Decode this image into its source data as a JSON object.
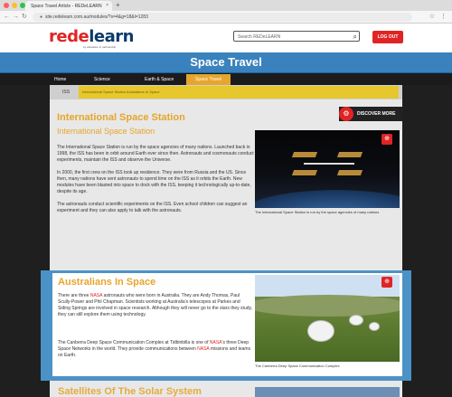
{
  "browser": {
    "tab_title": "Space Travel Article - REDeLEARN",
    "tab_close": "×",
    "new_tab": "+",
    "url": "site.redelearn.com.au/modules/?s=4&g=18&l=1283",
    "back": "←",
    "forward": "→",
    "reload": "↻",
    "right_icons": [
      "☆",
      "⋮"
    ]
  },
  "header": {
    "logo_red": "red",
    "logo_mid": "e",
    "logo_rest": "learn",
    "logo_sub": "by education in partnership",
    "search_placeholder": "Search REDeLEARN",
    "search_icon": "⌕",
    "logout": "LOG OUT"
  },
  "banner": {
    "title": "Space Travel"
  },
  "breadcrumb": [
    {
      "label": "Home"
    },
    {
      "label": "Science"
    },
    {
      "label": "Earth & Space"
    },
    {
      "label": "Space Travel"
    }
  ],
  "toolbar": {
    "left_label": "ISS",
    "yellow_text": "International Space Station   Australians In Space"
  },
  "discover": {
    "label": "DISCOVER MORE",
    "icon": "⚙"
  },
  "section_iss": {
    "title": "International Space Station",
    "subtitle": "International Space Station",
    "p1": "The International Space Station is run by the space agencies of many nations. Launched back in 1998, the ISS has been in orbit around Earth ever since then. Astronauts and cosmonauts conduct experiments, maintain the ISS and observe the Universe.",
    "p2": "In 2000, the first crew on the ISS took up residence. They were from Russia and the US. Since then, many nations have sent astronauts to spend time on the ISS as it orbits the Earth. New modules have been blasted into space to dock with the ISS, keeping it technologically up-to-date, despite its age.",
    "p3": "The astronauts conduct scientific experiments on the ISS. Even school children can suggest an experiment and they can also apply to talk with the astronauts.",
    "caption": "The International Space Station is run by the space agencies of many nations",
    "zoom_icon": "⊕"
  },
  "section_aus": {
    "title": "Australians In Space",
    "p1_a": "There are three ",
    "p1_hl": "NASA",
    "p1_b": " astronauts who were born in Australia. They are Andy Thomas, Paul Scully-Power and Phil Chapman. Scientists working at Australia's telescopes at Parkes and Siding Springs are involved in space research. Although they will never go to the stars they study, they can still explore them using technology.",
    "p2_a": "The Canberra Deep Space Communication Complex at Tidbinbilla is one of ",
    "p2_hl1": "NASA",
    "p2_b": "'s three Deep Space Networks in the world. They provide communications between ",
    "p2_hl2": "NASA",
    "p2_c": " missions and teams on Earth.",
    "caption": "The Canberra Deep Space Communication Complex",
    "zoom_icon": "⊕"
  },
  "section_next": {
    "title": "Satellites Of The Solar System"
  }
}
